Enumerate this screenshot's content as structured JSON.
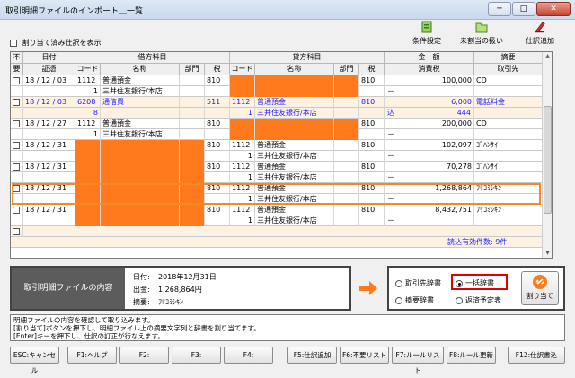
{
  "window": {
    "title": "取引明細ファイルのインポート＿一覧",
    "min": "─",
    "max": "□",
    "close": "✕"
  },
  "toolbar": [
    {
      "label": "条件設定",
      "icon": "settings-icon"
    },
    {
      "label": "未割当の扱い",
      "icon": "folder-icon"
    },
    {
      "label": "仕訳追加",
      "icon": "pen-icon"
    }
  ],
  "filter_label": "割り当て済み仕訳を表示",
  "headers": {
    "top": [
      "不",
      "日付",
      "借方科目",
      "貸方科目",
      "金　額",
      "摘要"
    ],
    "bottom": [
      "要",
      "証憑",
      "コード",
      "名称",
      "部門",
      "税",
      "コード",
      "名称",
      "部門",
      "税",
      "消費税",
      "取引先"
    ]
  },
  "rows": [
    {
      "date": "18 / 12 / 03",
      "dcode": "1112",
      "dname": "普通預金",
      "dtax": "810",
      "ccode": "",
      "cname": "",
      "ctax": "810",
      "amount": "100,000",
      "memo": "CD",
      "sub_dcode": "1",
      "sub_dname": "三井住友銀行/本店",
      "sub_ccode": "",
      "sub_cname": "",
      "sub_tax_mark": "－",
      "sub_tax": "",
      "dorange": false,
      "corange": true,
      "blue": false
    },
    {
      "date": "18 / 12 / 03",
      "dcode": "6208",
      "dname": "通信費",
      "dtax": "511",
      "ccode": "1112",
      "cname": "普通預金",
      "ctax": "810",
      "amount": "6,000",
      "memo": "電話料金",
      "sub_dcode": "8",
      "sub_dname": "",
      "sub_ccode": "1",
      "sub_cname": "三井住友銀行/本店",
      "sub_tax_mark": "込",
      "sub_tax": "444",
      "dorange": false,
      "corange": false,
      "blue": true
    },
    {
      "date": "18 / 12 / 27",
      "dcode": "1112",
      "dname": "普通預金",
      "dtax": "810",
      "ccode": "",
      "cname": "",
      "ctax": "810",
      "amount": "200,000",
      "memo": "CD",
      "sub_dcode": "1",
      "sub_dname": "三井住友銀行/本店",
      "sub_ccode": "",
      "sub_cname": "",
      "sub_tax_mark": "－",
      "sub_tax": "",
      "dorange": false,
      "corange": true,
      "blue": false
    },
    {
      "date": "18 / 12 / 31",
      "dcode": "",
      "dname": "",
      "dtax": "810",
      "ccode": "1112",
      "cname": "普通預金",
      "ctax": "810",
      "amount": "102,097",
      "memo": "ｺﾞﾊﾝｻｲ",
      "sub_dcode": "",
      "sub_dname": "",
      "sub_ccode": "1",
      "sub_cname": "三井住友銀行/本店",
      "sub_tax_mark": "－",
      "sub_tax": "",
      "dorange": true,
      "corange": false,
      "blue": false
    },
    {
      "date": "18 / 12 / 31",
      "dcode": "",
      "dname": "",
      "dtax": "810",
      "ccode": "1112",
      "cname": "普通預金",
      "ctax": "810",
      "amount": "70,278",
      "memo": "ｺﾞﾊﾝｻｲ",
      "sub_dcode": "",
      "sub_dname": "",
      "sub_ccode": "1",
      "sub_cname": "三井住友銀行/本店",
      "sub_tax_mark": "－",
      "sub_tax": "",
      "dorange": true,
      "corange": false,
      "blue": false
    },
    {
      "date": "18 / 12 / 31",
      "dcode": "",
      "dname": "",
      "dtax": "810",
      "ccode": "1112",
      "cname": "普通預金",
      "ctax": "810",
      "amount": "1,268,864",
      "memo": "ﾌﾘｺﾐｼｷﾝ",
      "sub_dcode": "",
      "sub_dname": "",
      "sub_ccode": "1",
      "sub_cname": "三井住友銀行/本店",
      "sub_tax_mark": "－",
      "sub_tax": "",
      "dorange": true,
      "corange": false,
      "blue": false
    },
    {
      "date": "18 / 12 / 31",
      "dcode": "",
      "dname": "",
      "dtax": "810",
      "ccode": "1112",
      "cname": "普通預金",
      "ctax": "810",
      "amount": "8,432,751",
      "memo": "ﾌﾘｺﾐｼｷﾝ",
      "sub_dcode": "",
      "sub_dname": "",
      "sub_ccode": "1",
      "sub_cname": "三井住友銀行/本店",
      "sub_tax_mark": "－",
      "sub_tax": "",
      "dorange": true,
      "corange": false,
      "blue": false
    }
  ],
  "summary_text": "読込有効件数: 9件",
  "detail": {
    "label": "取引明細ファイルの内容",
    "date_key": "日付:",
    "date_val": "2018年12月31日",
    "amount_key": "出金:",
    "amount_val": "1,268,864円",
    "memo_key": "摘要:",
    "memo_val": "ﾌﾘｺﾐｼｷﾝ"
  },
  "options": {
    "o1": "取引先辞書",
    "o2": "一括辞書",
    "o3": "摘要辞書",
    "o4": "返済予定表",
    "assign": "割り当て"
  },
  "message": [
    "明細ファイルの内容を確認して取り込みます。",
    "[割り当て]ボタンを押下し、明細ファイル上の摘要文字列と辞書を割り当てます。",
    "[Enter]キーを押下し、仕訳の訂正が行なえます。"
  ],
  "fkeys": [
    "ESC:キャンセル",
    "F1:ヘルプ",
    "F2:",
    "F3:",
    "F4:",
    "F5:仕訳追加",
    "F6:不要リスト",
    "F7:ルールリスト",
    "F8:ルール更新",
    "F12:仕訳書込"
  ],
  "colors": {
    "orange": "#ff7a1c",
    "highlight_border": "#e00000",
    "row_alt": "#fdf1e2"
  }
}
